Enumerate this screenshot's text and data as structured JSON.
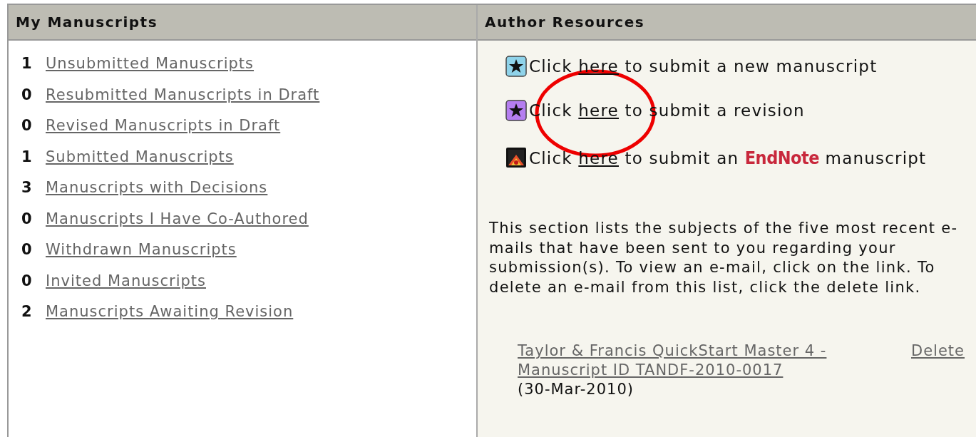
{
  "manuscripts": {
    "title": "My Manuscripts",
    "items": [
      {
        "count": "1",
        "label": "Unsubmitted Manuscripts"
      },
      {
        "count": "0",
        "label": "Resubmitted Manuscripts in Draft"
      },
      {
        "count": "0",
        "label": "Revised Manuscripts in Draft"
      },
      {
        "count": "1",
        "label": "Submitted Manuscripts"
      },
      {
        "count": "3",
        "label": "Manuscripts with Decisions"
      },
      {
        "count": "0",
        "label": "Manuscripts I Have Co-Authored"
      },
      {
        "count": "0",
        "label": "Withdrawn Manuscripts"
      },
      {
        "count": "0",
        "label": "Invited Manuscripts"
      },
      {
        "count": "2",
        "label": "Manuscripts Awaiting Revision"
      }
    ]
  },
  "resources": {
    "title": "Author Resources",
    "links": [
      {
        "kind": "new",
        "before": "Click ",
        "link": "here",
        "after": " to submit a new manuscript"
      },
      {
        "kind": "revision",
        "before": "Click ",
        "link": "here",
        "after": " to submit a revision"
      },
      {
        "kind": "endnote",
        "before": "Click ",
        "link": "here",
        "after": " to submit an ",
        "logo": "EndNote",
        "tail": " manuscript"
      }
    ],
    "note": "This section lists the subjects of the five most recent e-mails that have been sent to you regarding your submission(s). To view an e-mail, click on the link. To delete an e-mail from this list, click the delete link.",
    "emails": [
      {
        "subject": "Taylor & Francis QuickStart Master 4 - Manuscript ID TANDF-2010-0017",
        "delete": "Delete",
        "date": "(30-Mar-2010)"
      }
    ]
  }
}
